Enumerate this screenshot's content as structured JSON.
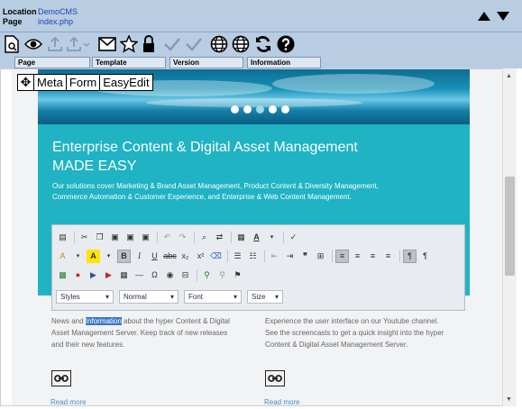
{
  "header": {
    "location_label": "Location",
    "location_value": "DemoCMS",
    "page_label": "Page",
    "page_value": "index.php"
  },
  "toolbar_icons": [
    "page-icon",
    "eye-icon",
    "upload-icon",
    "upload-dropdown-icon",
    "mail-icon",
    "star-icon",
    "lock-icon",
    "check-icon",
    "check-all-icon",
    "globe-icon",
    "globe-alt-icon",
    "refresh-icon",
    "help-icon"
  ],
  "tabs": [
    {
      "label": "Page"
    },
    {
      "label": "Template"
    },
    {
      "label": "Version"
    },
    {
      "label": "Information"
    }
  ],
  "overlay": {
    "meta": "Meta",
    "form": "Form",
    "easyedit": "EasyEdit"
  },
  "hero": {
    "title_line1": "Enterprise Content & Digital Asset Management",
    "title_line2": "MADE EASY",
    "description": "Our solutions cover Marketing & Brand Asset Management, Product Content & Diversity Management, Commerce Automation & Customer Experience, and Enterprise & Web Content Management."
  },
  "editor": {
    "styles": "Styles",
    "format": "Normal",
    "font": "Font",
    "size": "Size"
  },
  "columns": {
    "left_before": "News and ",
    "left_highlight": "Information",
    "left_after": " about the hyper Content & Digital Asset Management Server. Keep track of new releases and their new features.",
    "right_text": "Experience the user interface on our Youtube channel. See the screencasts to get a quick insight into the hyper Content & Digital Asset Management Server.",
    "read_more_left": "Read more",
    "read_more_right": "Read more"
  },
  "colors": {
    "header_bg": "#b8cde2",
    "teal": "#1fb3c4",
    "link": "#4a8fc5",
    "highlight": "#3a78c9"
  }
}
